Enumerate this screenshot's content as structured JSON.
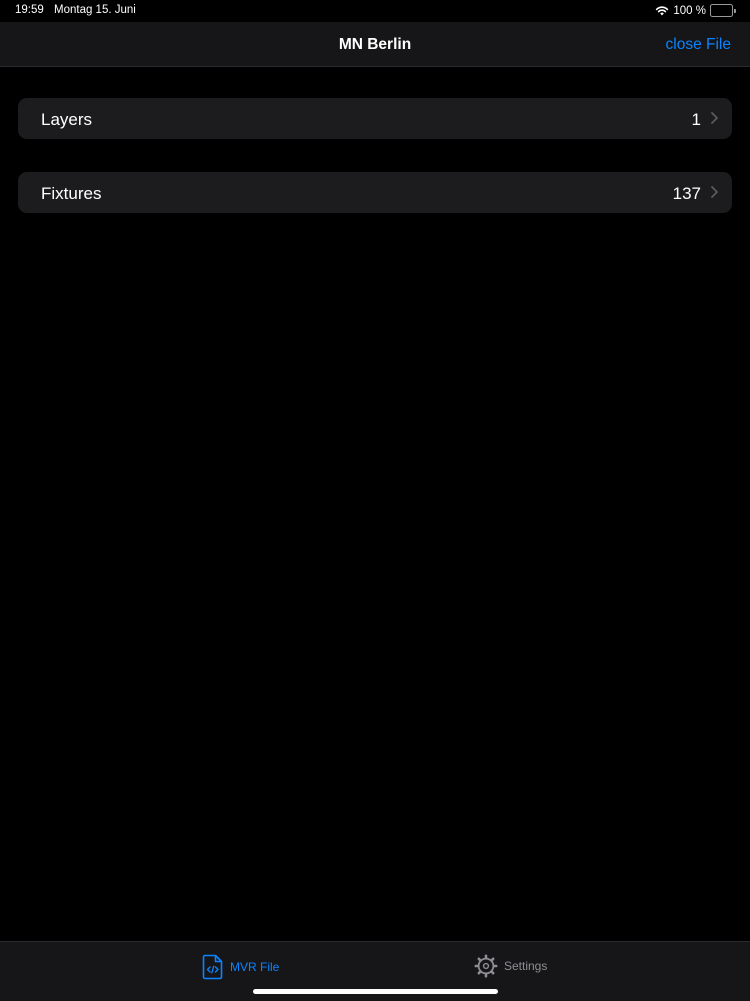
{
  "status_bar": {
    "time": "19:59",
    "date": "Montag 15. Juni",
    "battery": "100 %",
    "icons": [
      "wifi-icon",
      "battery-charging-icon"
    ]
  },
  "nav": {
    "title": "MN Berlin",
    "action_label": "close File"
  },
  "list": {
    "items": [
      {
        "label": "Layers",
        "value": "1"
      },
      {
        "label": "Fixtures",
        "value": "137"
      }
    ]
  },
  "tab_bar": {
    "tabs": [
      {
        "label": "MVR File",
        "icon": "code-document-icon",
        "selected": true
      },
      {
        "label": "Settings",
        "icon": "gear-icon",
        "selected": false
      }
    ]
  },
  "colors": {
    "accent": "#0a84ff",
    "background": "#000000",
    "cell": "#1c1c1e",
    "bar": "#161618",
    "inactive": "#8e8e93",
    "battery": "#34c759"
  }
}
